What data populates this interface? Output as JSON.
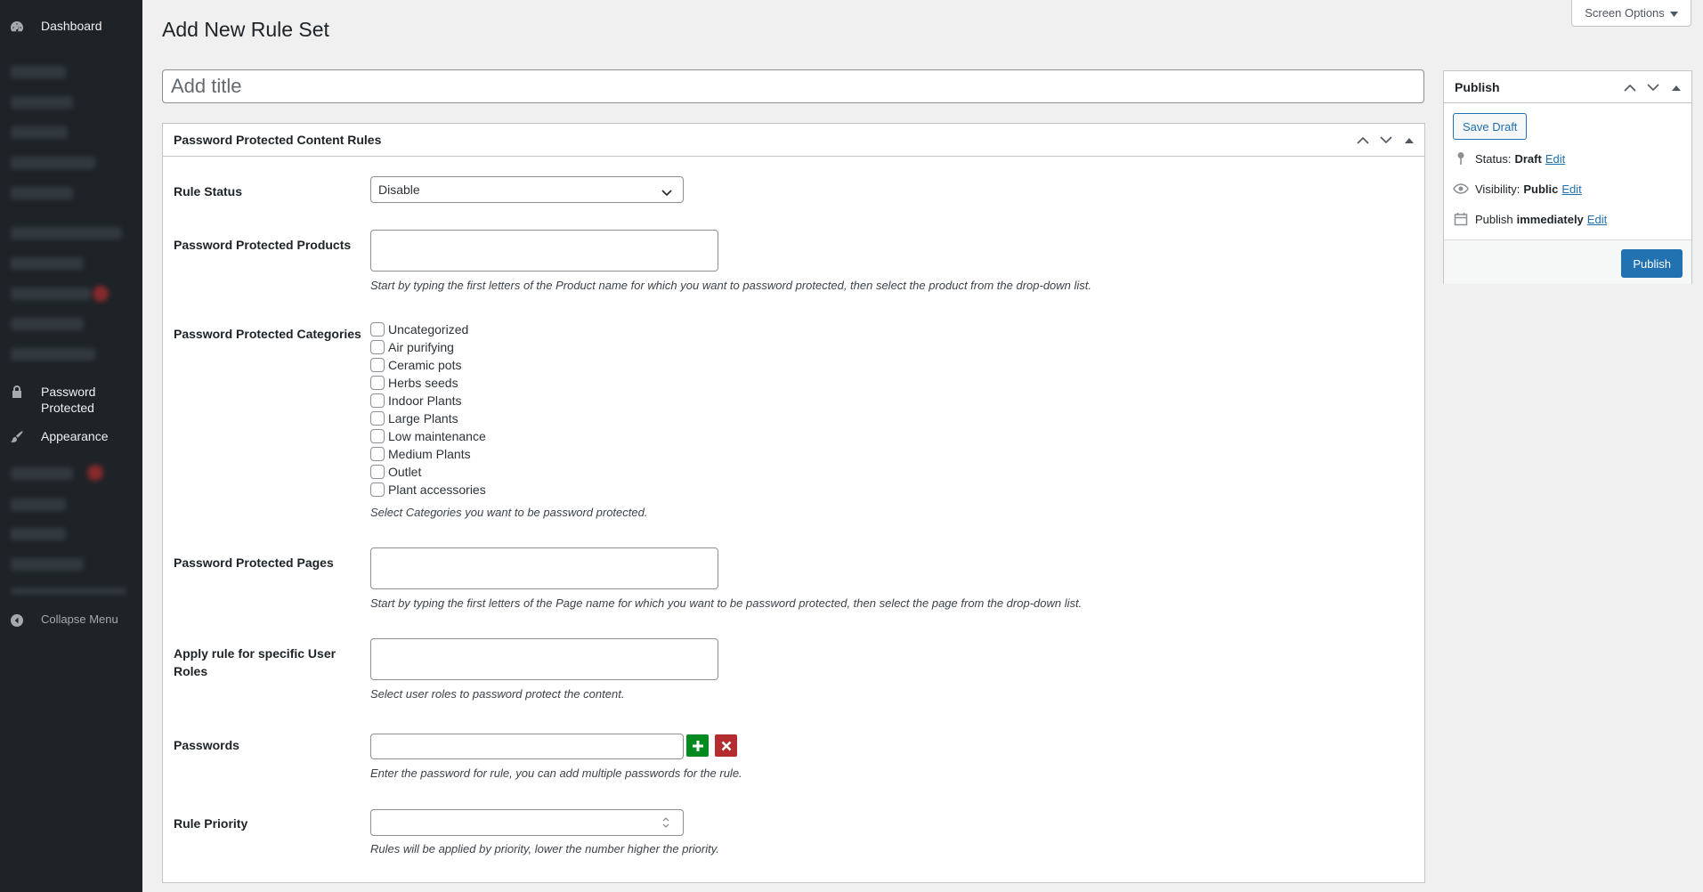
{
  "sidebar": {
    "dashboard_label": "Dashboard",
    "password_protected_label": "Password Protected",
    "appearance_label": "Appearance",
    "collapse_label": "Collapse Menu"
  },
  "header": {
    "page_title": "Add New Rule Set",
    "screen_options_label": "Screen Options"
  },
  "title_field": {
    "placeholder": "Add title",
    "value": ""
  },
  "rules_box": {
    "title": "Password Protected Content Rules",
    "rule_status": {
      "label": "Rule Status",
      "value": "Disable",
      "options": [
        "Disable"
      ]
    },
    "products": {
      "label": "Password Protected Products",
      "help": "Start by typing the first letters of the Product name for which you want to password protected, then select the product from the drop-down list."
    },
    "categories": {
      "label": "Password Protected Categories",
      "items": [
        "Uncategorized",
        "Air purifying",
        "Ceramic pots",
        "Herbs seeds",
        "Indoor Plants",
        "Large Plants",
        "Low maintenance",
        "Medium Plants",
        "Outlet",
        "Plant accessories"
      ],
      "help": "Select Categories you want to be password protected."
    },
    "pages": {
      "label": "Password Protected Pages",
      "help": "Start by typing the first letters of the Page name for which you want to be password protected, then select the page from the drop-down list."
    },
    "user_roles": {
      "label": "Apply rule for specific User Roles",
      "help": "Select user roles to password protect the content."
    },
    "passwords": {
      "label": "Passwords",
      "value": "",
      "help": "Enter the password for rule, you can add multiple passwords for the rule."
    },
    "priority": {
      "label": "Rule Priority",
      "value": "",
      "help": "Rules will be applied by priority, lower the number higher the priority."
    }
  },
  "publish_box": {
    "title": "Publish",
    "save_draft_label": "Save Draft",
    "status_label": "Status:",
    "status_value": "Draft",
    "visibility_label": "Visibility:",
    "visibility_value": "Public",
    "schedule_label": "Publish",
    "schedule_value": "immediately",
    "edit_label": "Edit",
    "publish_label": "Publish"
  },
  "colors": {
    "sidebar_bg": "#1d2327",
    "accent": "#2271b1",
    "add_button": "#008a20",
    "remove_button": "#b32d2e"
  },
  "icons": {
    "dashboard": "dashboard-icon",
    "lock": "lock-icon",
    "appearance": "paintbrush-icon",
    "collapse": "collapse-icon",
    "status": "pin-icon",
    "visibility": "eye-icon",
    "schedule": "calendar-icon"
  }
}
